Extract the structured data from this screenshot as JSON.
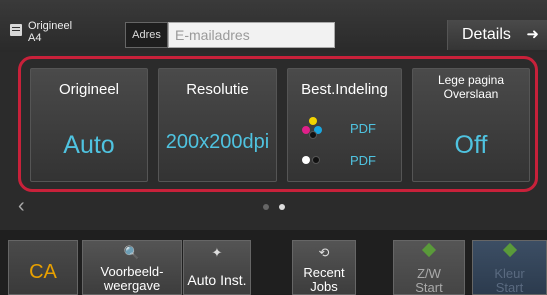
{
  "header": {
    "original_label": "Origineel",
    "original_size": "A4",
    "address_label": "Adres",
    "email_placeholder": "E-mailadres",
    "details_label": "Details",
    "details_arrow": "➜"
  },
  "settings": [
    {
      "title": "Origineel",
      "value": "Auto"
    },
    {
      "title": "Resolutie",
      "value": "200x200dpi"
    },
    {
      "title": "Best.Indeling",
      "color_format": "PDF",
      "bw_format": "PDF"
    },
    {
      "title_line1": "Lege pagina",
      "title_line2": "Overslaan",
      "value": "Off"
    }
  ],
  "pager": {
    "total": 2,
    "active": 2
  },
  "bottom": {
    "ca": "CA",
    "preview_line1": "Voorbeeld-",
    "preview_line2": "weergave",
    "auto_inst": "Auto Inst.",
    "recent_line1": "Recent",
    "recent_line2": "Jobs",
    "zw_line1": "Z/W",
    "zw_line2": "Start",
    "kleur_line1": "Kleur",
    "kleur_line2": "Start"
  },
  "colors": {
    "accent": "#4fc3e0",
    "highlight_frame": "#c8213a",
    "ca_text": "#e8a000"
  }
}
